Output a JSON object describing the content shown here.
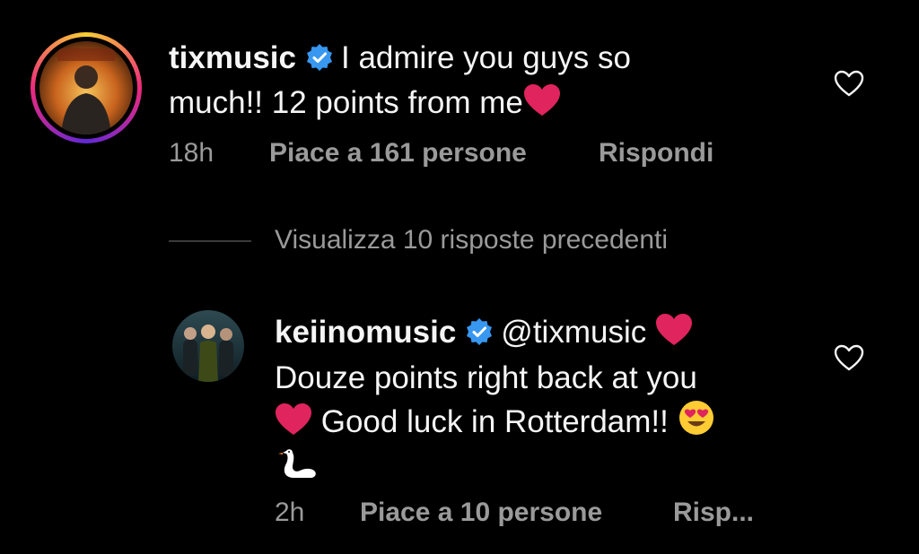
{
  "comments": [
    {
      "username": "tixmusic",
      "verified": true,
      "text_line1": "I admire you guys so",
      "text_line2": "much!! 12 points from me",
      "time": "18h",
      "likes": "Piace a 161 persone",
      "reply": "Rispondi"
    },
    {
      "username": "keiinomusic",
      "verified": true,
      "mention": "@tixmusic",
      "text_line2": "Douze points right back at you",
      "text_line3": "Good luck in Rotterdam!!",
      "time": "2h",
      "likes": "Piace a 10 persone",
      "reply": "Risp..."
    }
  ],
  "view_previous": "Visualizza 10 risposte precedenti",
  "colors": {
    "background": "#000000",
    "text": "#f5f5f5",
    "secondary": "#9a9a9a",
    "verified": "#3897f0",
    "heart": "#e0245e"
  },
  "icons": [
    "verified-badge-icon",
    "heart-outline-icon",
    "red-heart-emoji",
    "heart-eyes-emoji",
    "swan-emoji"
  ]
}
